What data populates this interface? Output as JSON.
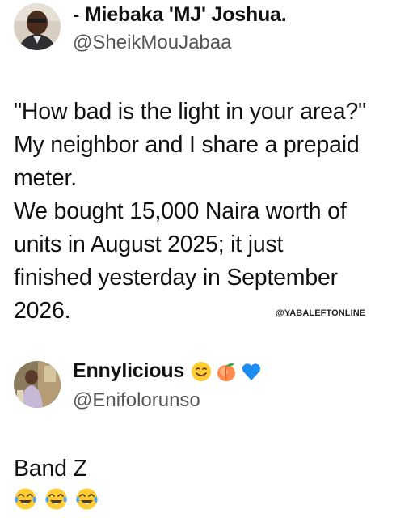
{
  "post1": {
    "display_name": "- Miebaka 'MJ' Joshua.",
    "handle": "@SheikMouJabaa",
    "text_lines": [
      "\"How bad is the light in your area?\"",
      "My neighbor and I share a prepaid",
      "meter.",
      "We bought 15,000 Naira worth of",
      "units in August 2025; it just",
      "finished yesterday in September",
      "2026."
    ],
    "watermark": "@YABALEFTONLINE"
  },
  "post2": {
    "display_name": "Ennylicious",
    "name_emojis": [
      "smiling-face-icon",
      "peach-icon",
      "blue-heart-icon"
    ],
    "handle": "@Enifolorunso",
    "text": "Band Z",
    "reply_emojis": [
      "tears-of-joy-icon",
      "tears-of-joy-icon",
      "tears-of-joy-icon"
    ]
  },
  "colors": {
    "text": "#111111",
    "handle": "#555555",
    "background": "#ffffff",
    "heart": "#1d8cf0",
    "emoji_yellow": "#ffcc33"
  }
}
